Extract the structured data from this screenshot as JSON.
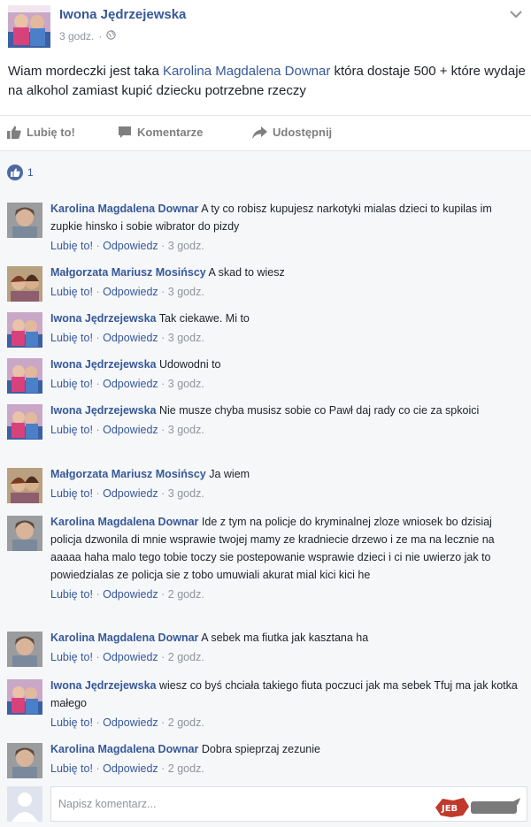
{
  "post": {
    "author": "Iwona Jędrzejewska",
    "time": "3 godz.",
    "text_before": "Wiam mordeczki jest taka ",
    "text_link": "Karolina Magdalena Downar",
    "text_after": " która dostaje 500 + które wydaje na alkohol zamiast kupić dziecku potrzebne rzeczy"
  },
  "actions": {
    "like": "Lubię to!",
    "comment": "Komentarze",
    "share": "Udostępnij"
  },
  "reactions": {
    "count": "1"
  },
  "comments": [
    {
      "name": "Karolina Magdalena Downar",
      "text": "A ty co robisz kupujesz narkotyki mialas dzieci to kupilas im zupkie hinsko i sobie wibrator do pizdy",
      "like": "Lubię to!",
      "reply": "Odpowiedz",
      "time": "3 godz."
    },
    {
      "name": "Małgorzata Mariusz Mosińscy",
      "text": "A skad to wiesz",
      "like": "Lubię to!",
      "reply": "Odpowiedz",
      "time": "3 godz."
    },
    {
      "name": "Iwona Jędrzejewska",
      "text": "Tak ciekawe. Mi to",
      "like": "Lubię to!",
      "reply": "Odpowiedz",
      "time": "3 godz."
    },
    {
      "name": "Iwona Jędrzejewska",
      "text": "Udowodni to",
      "like": "Lubię to!",
      "reply": "Odpowiedz",
      "time": "3 godz."
    },
    {
      "name": "Iwona Jędrzejewska",
      "text": "Nie musze chyba musisz sobie co Pawł daj rady co cie za spkoici",
      "like": "Lubię to!",
      "reply": "Odpowiedz",
      "time": "3 godz."
    },
    {
      "name": "Małgorzata Mariusz Mosińscy",
      "text": "Ja wiem",
      "like": "Lubię to!",
      "reply": "Odpowiedz",
      "time": "3 godz."
    },
    {
      "name": "Karolina Magdalena Downar",
      "text": "Ide z tym na policje do kryminalnej zloze wniosek bo dzisiaj policja dzwonila di mnie wsprawie twojej mamy ze kradniecie drzewo i ze ma na lecznie na aaaaa haha malo tego tobie toczy sie postepowanie wsprawie dzieci i ci nie uwierzo jak to powiedzialas ze policja sie z tobo umuwiali akurat mial kici kici he",
      "like": "Lubię to!",
      "reply": "Odpowiedz",
      "time": "2 godz."
    },
    {
      "name": "Karolina Magdalena Downar",
      "text": "A sebek ma fiutka jak kasztana ha",
      "like": "Lubię to!",
      "reply": "Odpowiedz",
      "time": "2 godz."
    },
    {
      "name": "Iwona Jędrzejewska",
      "text": "wiesz co byś chciała takiego fiuta poczuci jak ma sebek Tfuj ma jak kotka małego",
      "like": "Lubię to!",
      "reply": "Odpowiedz",
      "time": "2 godz."
    },
    {
      "name": "Karolina Magdalena Downar",
      "text": "Dobra spieprzaj zezunie",
      "like": "Lubię to!",
      "reply": "Odpowiedz",
      "time": "2 godz."
    }
  ],
  "write_comment": {
    "placeholder": "Napisz komentarz..."
  },
  "watermark": {
    "text": "JEB"
  },
  "colors": {
    "link": "#365899",
    "meta": "#90949c",
    "comments_bg": "#f6f7f9",
    "like_badge": "#4e69a2"
  }
}
